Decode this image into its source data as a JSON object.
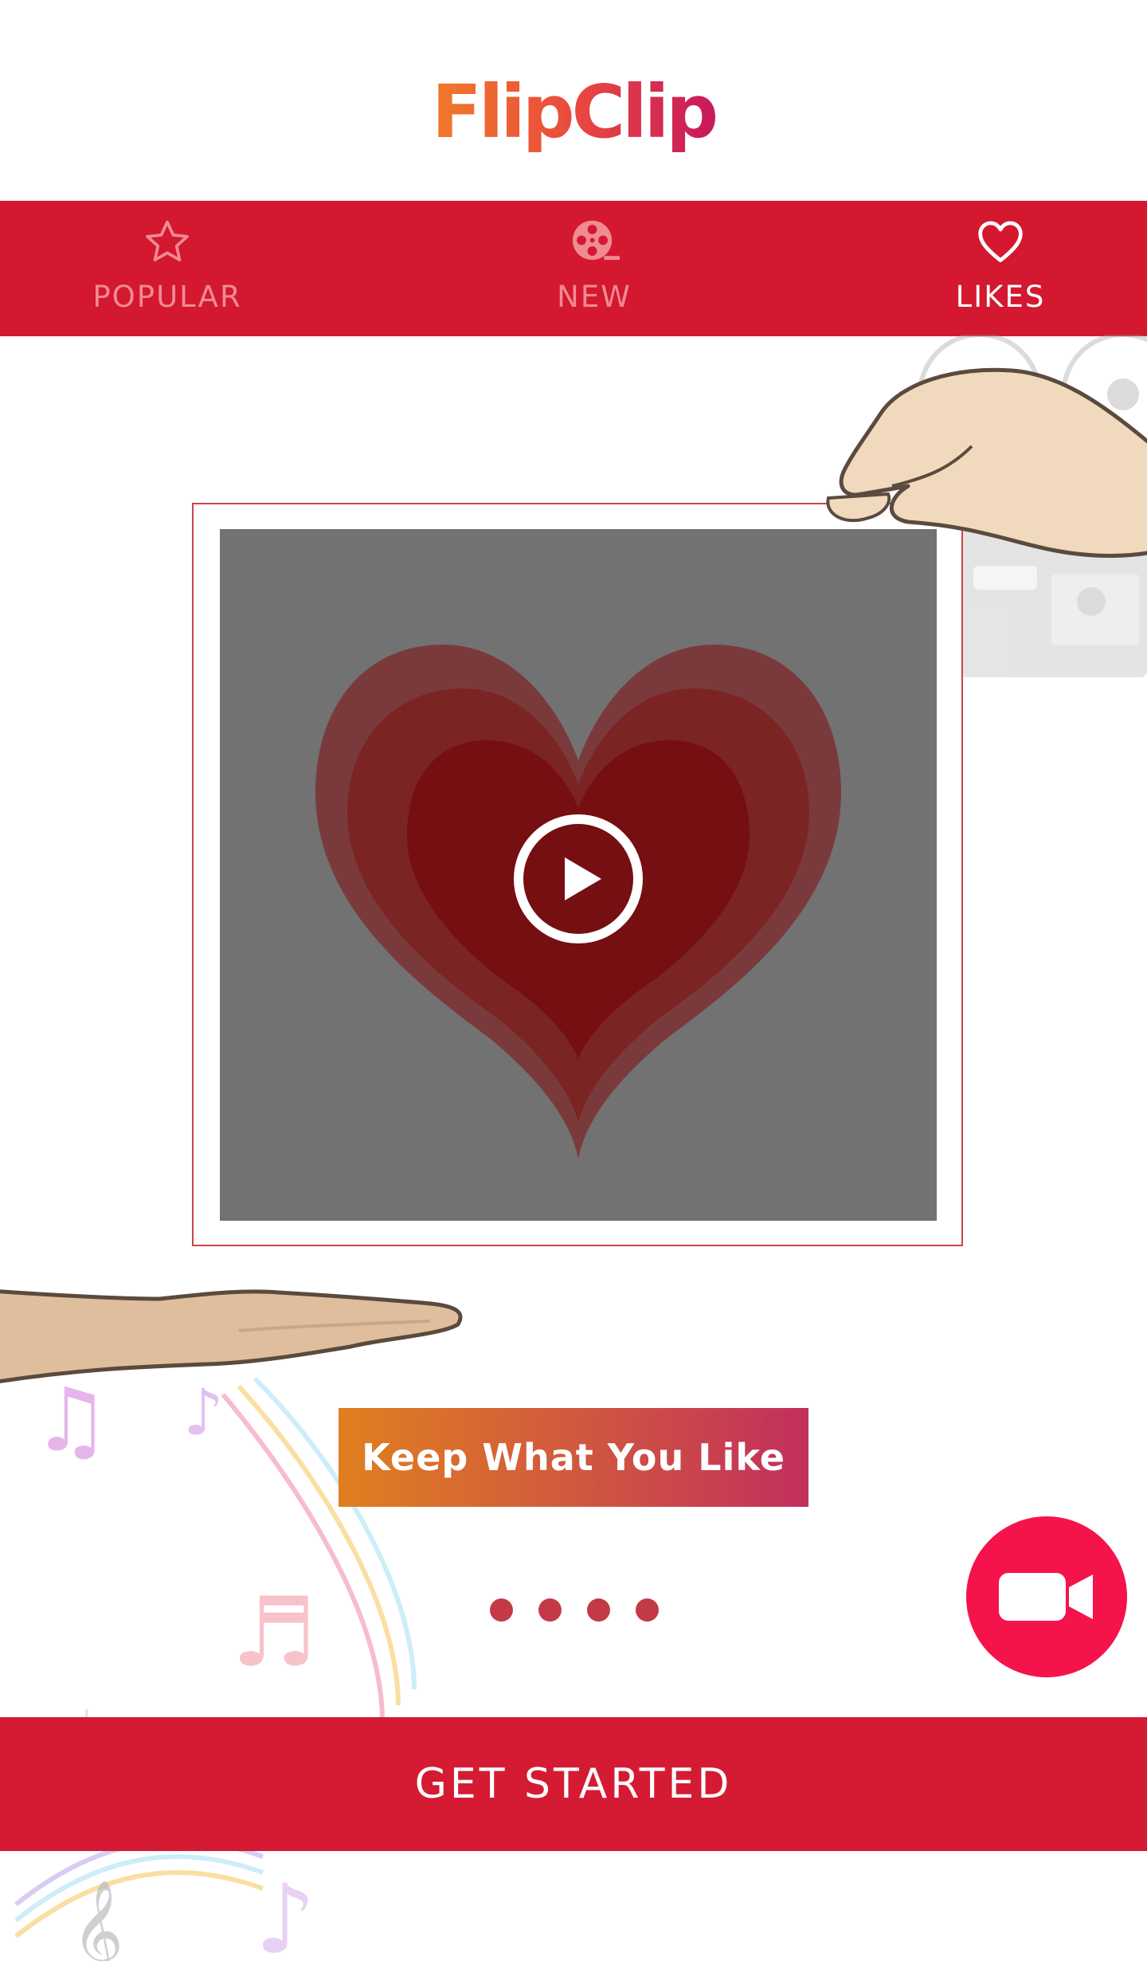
{
  "app": {
    "logo_text": "FlipClip"
  },
  "tabs": [
    {
      "label": "POPULAR",
      "icon": "star-icon",
      "active": false
    },
    {
      "label": "NEW",
      "icon": "film-reel-icon",
      "active": false
    },
    {
      "label": "LIKES",
      "icon": "heart-icon",
      "active": true
    }
  ],
  "video": {
    "thumbnail": "layered-heart",
    "control_icon": "play-icon"
  },
  "banner": {
    "text": "Keep What You Like"
  },
  "pager": {
    "count": 4
  },
  "fab": {
    "icon": "video-camera-icon"
  },
  "cta": {
    "label": "GET STARTED"
  },
  "colors": {
    "brand_red": "#d4182f",
    "fab_pink": "#f5134c",
    "logo_orange": "#f07a2a",
    "logo_magenta": "#c8185c"
  }
}
